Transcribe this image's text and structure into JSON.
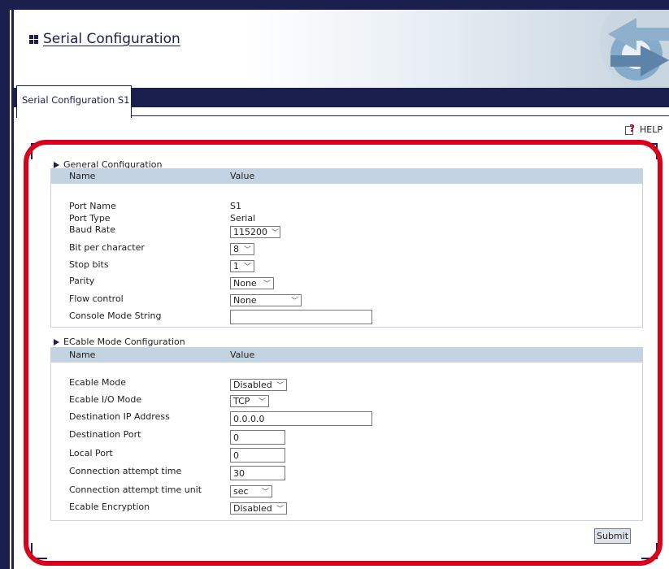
{
  "header": {
    "title": "Serial Configuration"
  },
  "tab": {
    "label": "Serial Configuration S1"
  },
  "help": {
    "label": "HELP"
  },
  "general": {
    "title": "General Configuration",
    "col_name": "Name",
    "col_value": "Value",
    "rows": {
      "port_name": {
        "label": "Port Name",
        "value": "S1"
      },
      "port_type": {
        "label": "Port Type",
        "value": "Serial"
      },
      "baud_rate": {
        "label": "Baud Rate",
        "value": "115200"
      },
      "bits": {
        "label": "Bit per character",
        "value": "8"
      },
      "stop_bits": {
        "label": "Stop bits",
        "value": "1"
      },
      "parity": {
        "label": "Parity",
        "value": "None"
      },
      "flow": {
        "label": "Flow control",
        "value": "None"
      },
      "console": {
        "label": "Console Mode String",
        "value": ""
      }
    }
  },
  "ecable": {
    "title": "ECable Mode Configuration",
    "col_name": "Name",
    "col_value": "Value",
    "rows": {
      "mode": {
        "label": "Ecable Mode",
        "value": "Disabled"
      },
      "io_mode": {
        "label": "Ecable I/O Mode",
        "value": "TCP"
      },
      "dest_ip": {
        "label": "Destination IP Address",
        "value": "0.0.0.0"
      },
      "dest_port": {
        "label": "Destination Port",
        "value": "0"
      },
      "local_port": {
        "label": "Local Port",
        "value": "0"
      },
      "attempt_time": {
        "label": "Connection attempt time",
        "value": "30"
      },
      "attempt_unit": {
        "label": "Connection attempt time unit",
        "value": "sec"
      },
      "encryption": {
        "label": "Ecable Encryption",
        "value": "Disabled"
      }
    }
  },
  "submit": {
    "label": "Submit"
  },
  "colors": {
    "navy": "#1a1f4e",
    "table_header": "#c4d3e1",
    "highlight": "#d8001a"
  }
}
